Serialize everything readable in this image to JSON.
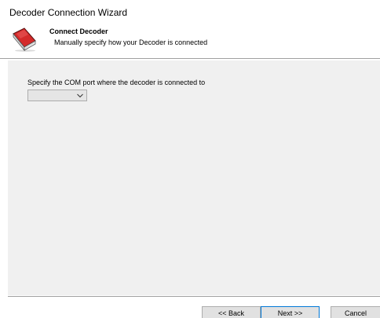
{
  "window": {
    "title": "Decoder Connection Wizard"
  },
  "header": {
    "title": "Connect Decoder",
    "subtitle": "Manually specify how your Decoder is connected",
    "icon": "red-book-icon"
  },
  "content": {
    "com_port_label": "Specify the COM port where the decoder is connected to",
    "com_port_value": ""
  },
  "footer": {
    "back_label": "<< Back",
    "next_label": "Next >>",
    "cancel_label": "Cancel"
  },
  "colors": {
    "content_bg": "#f0f0f0",
    "button_bg": "#e1e1e1",
    "focus_border": "#0078d7",
    "icon_red": "#d42a2a"
  }
}
